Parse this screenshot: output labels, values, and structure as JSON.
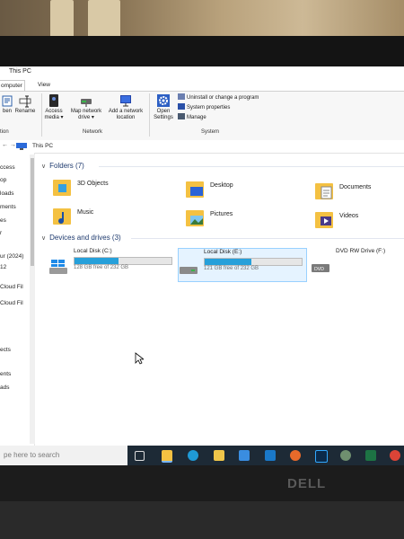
{
  "window": {
    "title": "This PC"
  },
  "tabs": [
    {
      "label": "omputer",
      "active": true
    },
    {
      "label": "View",
      "active": false
    }
  ],
  "ribbon": {
    "buttons": [
      {
        "label": "ben",
        "icon": "properties-icon"
      },
      {
        "label": "Rename",
        "icon": "rename-icon"
      },
      {
        "label": "Access media ▾",
        "icon": "access-media-icon"
      },
      {
        "label": "Map network drive ▾",
        "icon": "map-network-drive-icon"
      },
      {
        "label": "Add a network location",
        "icon": "network-location-icon"
      },
      {
        "label": "Open Settings",
        "icon": "settings-gear-icon"
      }
    ],
    "system_items": [
      {
        "label": "Uninstall or change a program",
        "icon": "uninstall-icon"
      },
      {
        "label": "System properties",
        "icon": "system-properties-icon"
      },
      {
        "label": "Manage",
        "icon": "manage-icon"
      }
    ],
    "groups": {
      "location": "tion",
      "network": "Network",
      "system": "System"
    }
  },
  "address": {
    "path": "This PC",
    "arrows": "← →  ↑"
  },
  "nav": {
    "items": [
      "ccess",
      "op",
      "loads",
      "ments",
      "es",
      "r",
      "ur (2024)",
      "12",
      "Cloud Fil",
      "Cloud Fil",
      "ects",
      "ents",
      "ads"
    ]
  },
  "folders_section": {
    "title": "Folders (7)"
  },
  "folders": [
    {
      "label": "3D Objects",
      "icon": "3d-objects-folder-icon"
    },
    {
      "label": "Desktop",
      "icon": "desktop-folder-icon"
    },
    {
      "label": "Documents",
      "icon": "documents-folder-icon"
    },
    {
      "label": "Music",
      "icon": "music-folder-icon"
    },
    {
      "label": "Pictures",
      "icon": "pictures-folder-icon"
    },
    {
      "label": "Videos",
      "icon": "videos-folder-icon"
    }
  ],
  "drives_section": {
    "title": "Devices and drives (3)"
  },
  "drives": [
    {
      "name": "Local Disk (C:)",
      "free": "128 GB free of 232 GB",
      "used_fraction": 0.45,
      "icon": "windows-drive-icon"
    },
    {
      "name": "Local Disk (E:)",
      "free": "121 GB free of 232 GB",
      "used_fraction": 0.48,
      "icon": "hard-drive-icon"
    },
    {
      "name": "DVD RW Drive (F:)",
      "free": "",
      "icon": "dvd-drive-icon"
    }
  ],
  "taskbar": {
    "search_placeholder": "pe here to search",
    "icons": [
      "task-view-icon",
      "file-explorer-icon",
      "edge-icon",
      "store-icon",
      "remote-desktop-icon",
      "mail-icon",
      "firefox-icon",
      "photoshop-icon",
      "app-icon",
      "excel-icon",
      "chrome-icon"
    ]
  },
  "colors": {
    "accent": "#26a0da",
    "folder": "#f4c142",
    "taskbar": "#1d2a36"
  },
  "monitor": {
    "brand": "DELL"
  }
}
